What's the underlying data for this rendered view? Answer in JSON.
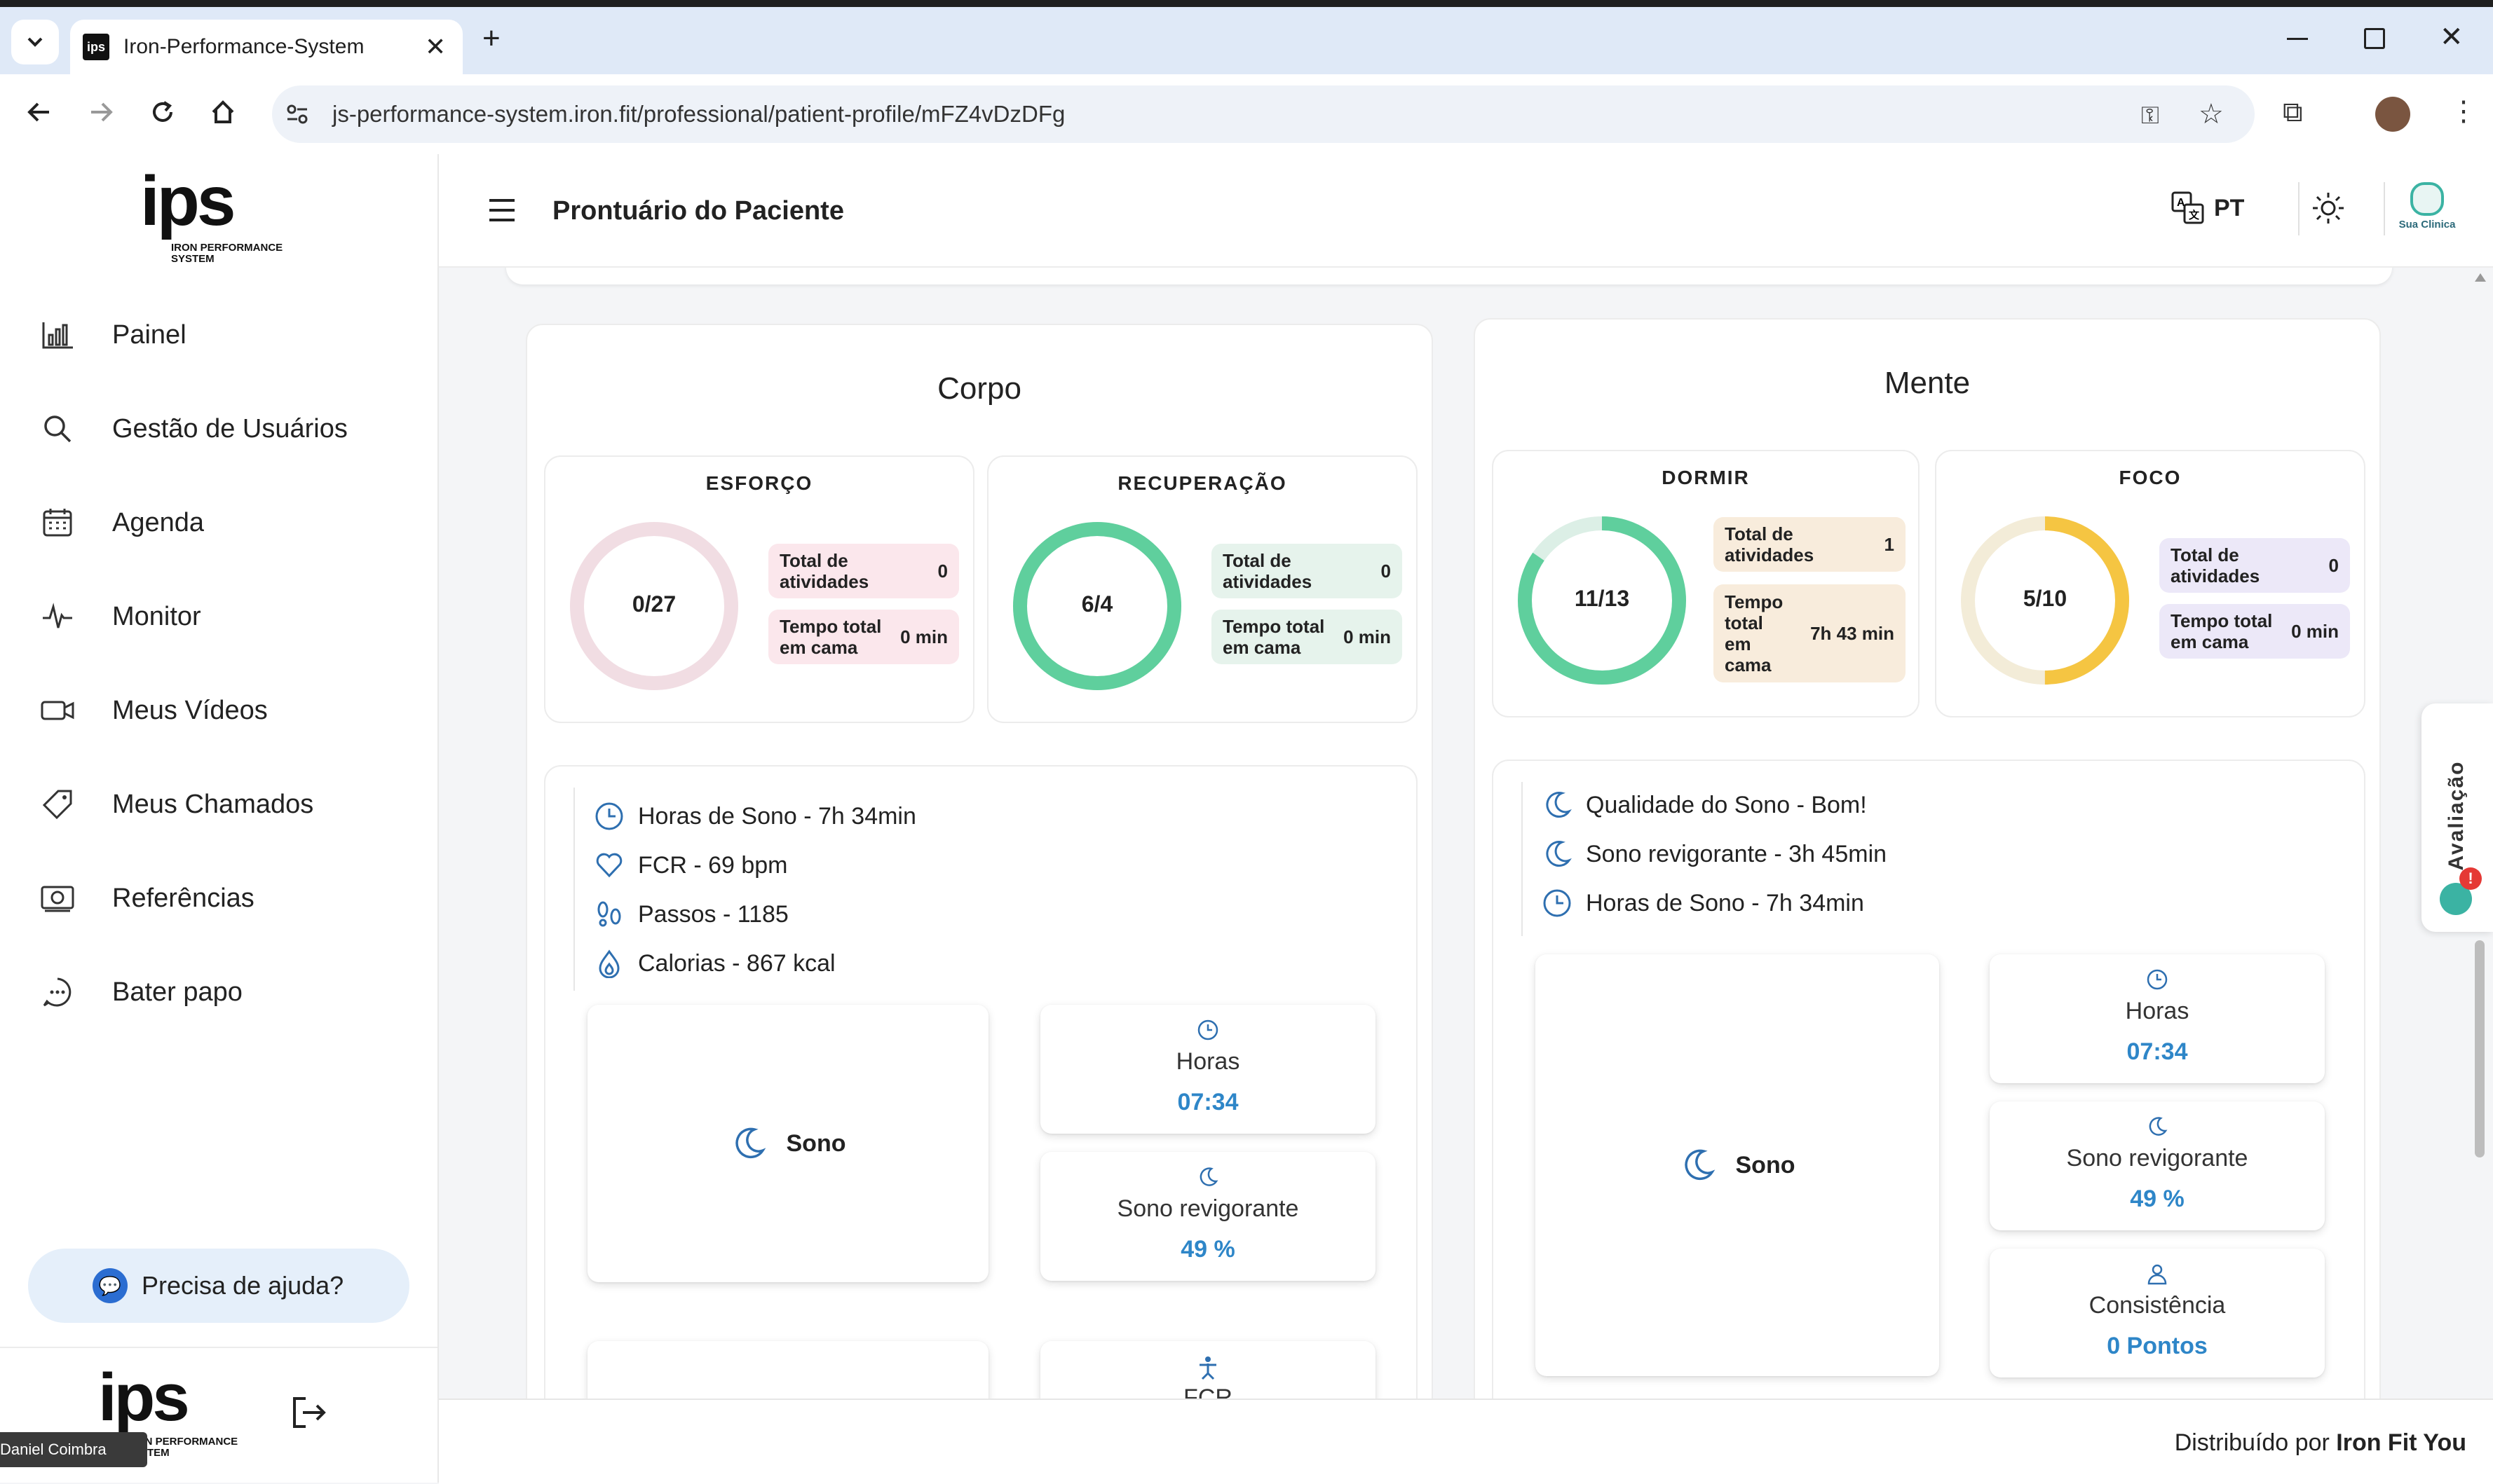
{
  "browser": {
    "tab_title": "Iron-Performance-System",
    "tab_favicon": "ips",
    "url": "js-performance-system.iron.fit/professional/patient-profile/mFZ4vDzDFg"
  },
  "brand": {
    "logo_text": "ips",
    "logo_sub": "IRON PERFORMANCE SYSTEM"
  },
  "sidebar": {
    "items": [
      {
        "label": "Painel",
        "icon": "bar-chart-icon"
      },
      {
        "label": "Gestão de Usuários",
        "icon": "search-icon"
      },
      {
        "label": "Agenda",
        "icon": "calendar-icon"
      },
      {
        "label": "Monitor",
        "icon": "pulse-icon"
      },
      {
        "label": "Meus Vídeos",
        "icon": "video-icon"
      },
      {
        "label": "Meus Chamados",
        "icon": "ticket-icon"
      },
      {
        "label": "Referências",
        "icon": "money-icon"
      },
      {
        "label": "Bater papo",
        "icon": "chat-icon"
      }
    ],
    "help_label": "Precisa de ajuda?"
  },
  "header": {
    "title": "Prontuário do Paciente",
    "language": "PT",
    "clinic_logo": "Sua Clinica"
  },
  "footer": {
    "text": "Distribuído por",
    "brand": "Iron Fit You"
  },
  "user_overlay": "Daniel Coimbra",
  "avaliacao_tab": "Avaliação",
  "corpo": {
    "title": "Corpo",
    "esforco": {
      "title": "ESFORÇO",
      "ring": "0/27",
      "progress": 0,
      "color": "#f1dde3",
      "total_label": "Total de atividades",
      "total_value": "0",
      "tempo_label": "Tempo total em cama",
      "tempo_value": "0 min",
      "pill_bg": "#fbe7ec"
    },
    "recuperacao": {
      "title": "RECUPERAÇÃO",
      "ring": "6/4",
      "progress": 1,
      "color": "#5fcf9d",
      "total_label": "Total de atividades",
      "total_value": "0",
      "tempo_label": "Tempo total em cama",
      "tempo_value": "0 min",
      "pill_bg": "#e6f3ec"
    },
    "info": [
      {
        "icon": "clock-icon",
        "text": "Horas de Sono - 7h 34min"
      },
      {
        "icon": "heart-icon",
        "text": "FCR - 69 bpm"
      },
      {
        "icon": "footsteps-icon",
        "text": "Passos - 1185"
      },
      {
        "icon": "flame-icon",
        "text": "Calorias - 867 kcal"
      }
    ],
    "sono_label": "Sono",
    "horas": {
      "label": "Horas",
      "value": "07:34"
    },
    "revigorante": {
      "label": "Sono revigorante",
      "value": "49 %"
    },
    "fcr_label": "FCR"
  },
  "mente": {
    "title": "Mente",
    "dormir": {
      "title": "DORMIR",
      "ring": "11/13",
      "progress": 0.846,
      "color": "#5fcf9d",
      "total_label": "Total de atividades",
      "total_value": "1",
      "tempo_label": "Tempo total em cama",
      "tempo_value": "7h 43 min",
      "pill_bg": "#f8ecdc"
    },
    "foco": {
      "title": "FOCO",
      "ring": "5/10",
      "progress": 0.5,
      "color": "#f5c542",
      "total_label": "Total de atividades",
      "total_value": "0",
      "tempo_label": "Tempo total em cama",
      "tempo_value": "0 min",
      "pill_bg": "#ece8f8"
    },
    "info": [
      {
        "icon": "moon-icon",
        "text": "Qualidade do Sono - Bom!"
      },
      {
        "icon": "moon-icon",
        "text": "Sono revigorante - 3h 45min"
      },
      {
        "icon": "clock-icon",
        "text": "Horas de Sono - 7h 34min"
      }
    ],
    "sono_label": "Sono",
    "horas": {
      "label": "Horas",
      "value": "07:34"
    },
    "revigorante": {
      "label": "Sono revigorante",
      "value": "49 %"
    },
    "consistencia": {
      "label": "Consistência",
      "value": "0 Pontos"
    }
  }
}
